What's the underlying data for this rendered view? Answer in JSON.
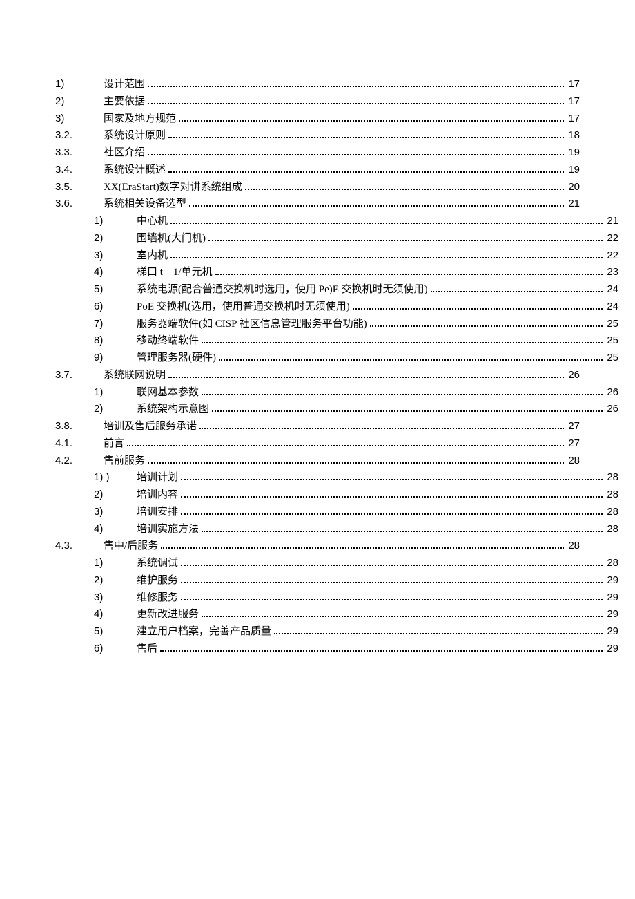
{
  "toc": [
    {
      "level": 0,
      "num": "1)",
      "title": "设计范围",
      "page": "17"
    },
    {
      "level": 0,
      "num": "2)",
      "title": "主要依据",
      "page": "17"
    },
    {
      "level": 0,
      "num": "3)",
      "title": "国家及地方规范",
      "page": "17"
    },
    {
      "level": 0,
      "num": "3.2.",
      "title": "系统设计原则",
      "page": "18"
    },
    {
      "level": 0,
      "num": "3.3.",
      "title": "社区介绍",
      "page": "19"
    },
    {
      "level": 0,
      "num": "3.4.",
      "title": "系统设计概述",
      "page": "19"
    },
    {
      "level": 0,
      "num": "3.5.",
      "title": "XX(EraStart)数字对讲系统组成",
      "page": "20"
    },
    {
      "level": 0,
      "num": "3.6.",
      "title": "系统相关设备选型",
      "page": "21"
    },
    {
      "level": 1,
      "num": "1)",
      "title": "中心机",
      "page": "21"
    },
    {
      "level": 1,
      "num": "2)",
      "title": "围墙机(大门机)",
      "page": "22"
    },
    {
      "level": 1,
      "num": "3)",
      "title": "室内机",
      "page": "22"
    },
    {
      "level": 1,
      "num": "4)",
      "title": "梯口 t｜1/单元机",
      "page": "23"
    },
    {
      "level": 1,
      "num": "5)",
      "title": "系统电源(配合普通交换机时选用，使用 Pe)E 交换机时无须使用)",
      "page": "24"
    },
    {
      "level": 1,
      "num": "6)",
      "title": "PoE 交换机(选用，使用普通交换机时无须使用)",
      "page": "24"
    },
    {
      "level": 1,
      "num": "7)",
      "title": "服务器端软件(如 CISP 社区信息管理服务平台功能)",
      "page": "25"
    },
    {
      "level": 1,
      "num": "8)",
      "title": "移动终端软件",
      "page": "25"
    },
    {
      "level": 1,
      "num": "9)",
      "title": "管理服务器(硬件)",
      "page": "25"
    },
    {
      "level": 0,
      "num": "3.7.",
      "title": "系统联网说明",
      "page": "26"
    },
    {
      "level": 1,
      "num": "1)",
      "title": "联网基本参数",
      "page": "26"
    },
    {
      "level": 1,
      "num": "2)",
      "title": "系统架构示意图",
      "page": "26"
    },
    {
      "level": 0,
      "num": "3.8.",
      "title": "培训及售后服务承诺",
      "page": "27"
    },
    {
      "level": 0,
      "num": "4.1.",
      "title": "前言",
      "page": "27"
    },
    {
      "level": 0,
      "num": "4.2.",
      "title": "售前服务",
      "page": "28"
    },
    {
      "level": 1,
      "num": "1) )",
      "title": "培训计划",
      "page": "28"
    },
    {
      "level": 1,
      "num": "2)",
      "title": "培训内容",
      "page": "28"
    },
    {
      "level": 1,
      "num": "3)",
      "title": "培训安排",
      "page": "28"
    },
    {
      "level": 1,
      "num": "4)",
      "title": "培训实施方法",
      "page": "28"
    },
    {
      "level": 0,
      "num": "4.3.",
      "title": "售中/后服务",
      "page": "28"
    },
    {
      "level": 1,
      "num": "1)",
      "title": "系统调试",
      "page": "28"
    },
    {
      "level": 1,
      "num": "2)",
      "title": "维护服务",
      "page": "29"
    },
    {
      "level": 1,
      "num": "3)",
      "title": "维修服务",
      "page": "29"
    },
    {
      "level": 1,
      "num": "4)",
      "title": "更新改进服务",
      "page": "29"
    },
    {
      "level": 1,
      "num": "5)",
      "title": "建立用户档案，完善产品质量",
      "page": "29"
    },
    {
      "level": 1,
      "num": "6)",
      "title": "售后",
      "page": "29"
    }
  ]
}
